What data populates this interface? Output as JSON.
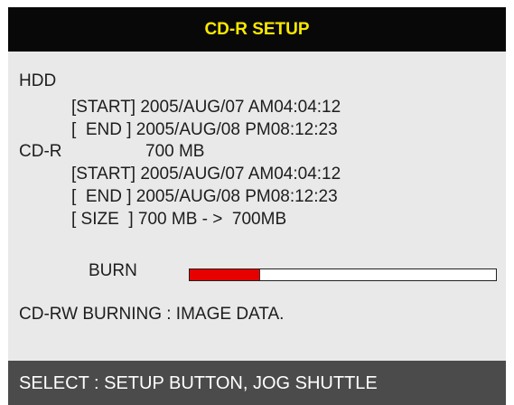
{
  "header": {
    "title": "CD-R SETUP"
  },
  "hdd": {
    "label": "HDD",
    "start": "[START] 2005/AUG/07 AM04:04:12",
    "end": "[  END ] 2005/AUG/08 PM08:12:23"
  },
  "cdr": {
    "label": "CD-R",
    "capacity": "700 MB",
    "start": "[START] 2005/AUG/07 AM04:04:12",
    "end": "[  END ] 2005/AUG/08 PM08:12:23",
    "size": "[ SIZE  ] 700 MB - >  700MB"
  },
  "burn": {
    "label": "BURN",
    "progress_fraction": 0.23
  },
  "status": {
    "text": "CD-RW BURNING : IMAGE DATA."
  },
  "footer": {
    "text": "SELECT : SETUP BUTTON, JOG SHUTTLE"
  },
  "colors": {
    "title_background": "#080808",
    "title_text": "#f8e800",
    "panel_background": "#e9e9e9",
    "progress_fill": "#e60000",
    "footer_background": "#4b4b4b",
    "footer_text": "#ffffff"
  }
}
